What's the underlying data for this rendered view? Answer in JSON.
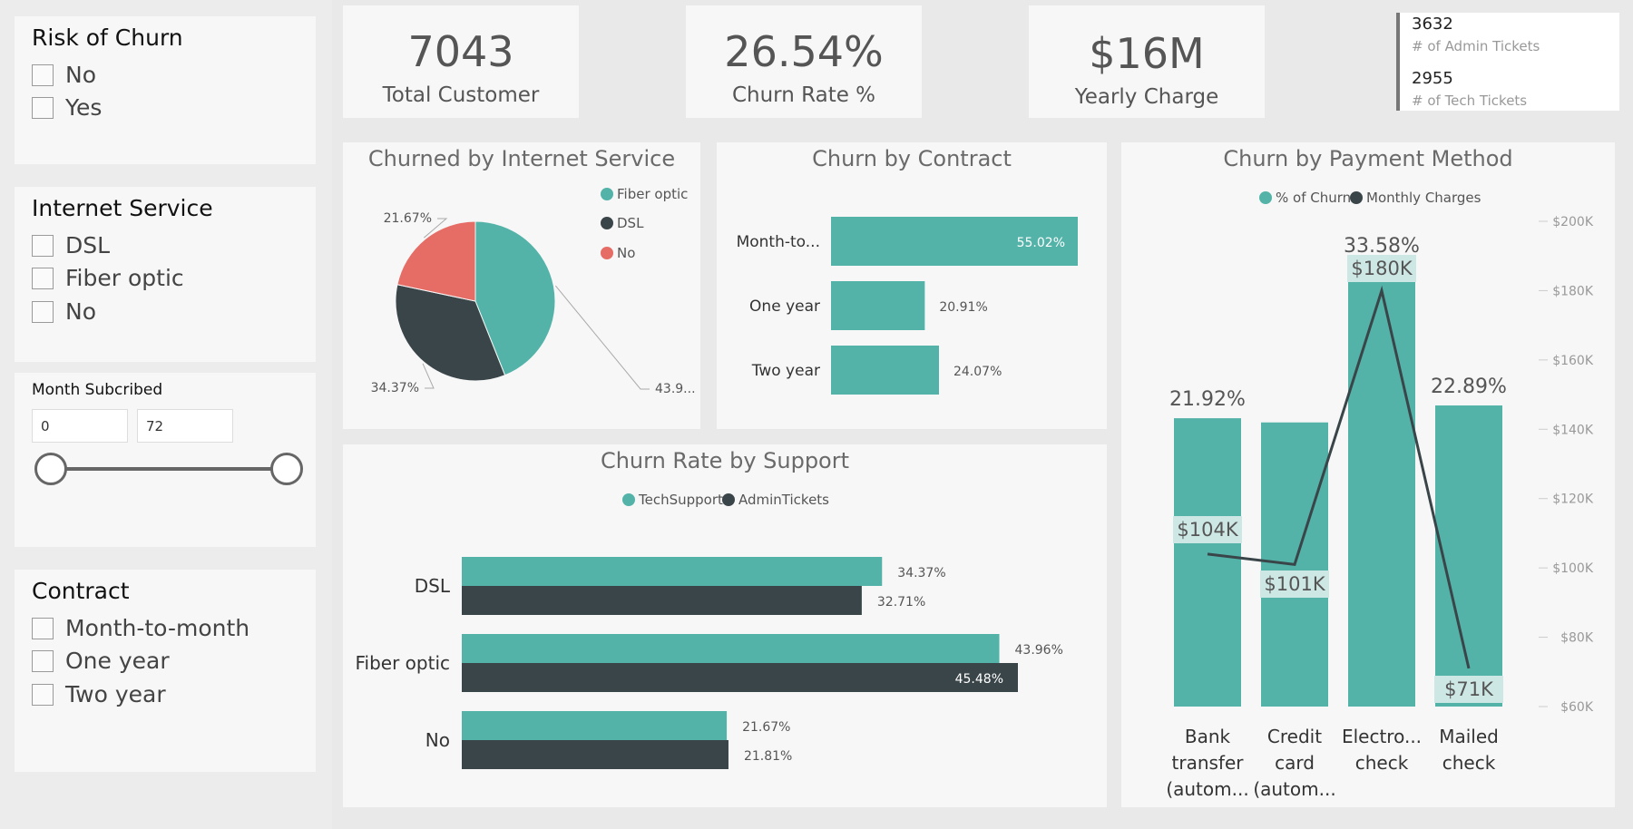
{
  "slicers": {
    "risk": {
      "title": "Risk of Churn",
      "options": [
        "No",
        "Yes"
      ]
    },
    "internet": {
      "title": "Internet Service",
      "options": [
        "DSL",
        "Fiber optic",
        "No"
      ]
    },
    "month": {
      "title": "Month Subcribed",
      "min": "0",
      "max": "72"
    },
    "contract": {
      "title": "Contract",
      "options": [
        "Month-to-month",
        "One year",
        "Two year"
      ]
    }
  },
  "kpis": [
    {
      "value": "7043",
      "label": "Total Customer"
    },
    {
      "value": "26.54%",
      "label": "Churn Rate %"
    },
    {
      "value": "$16M",
      "label": "Yearly Charge"
    }
  ],
  "tickets": {
    "admin_value": "3632",
    "admin_label": "# of Admin Tickets",
    "tech_value": "2955",
    "tech_label": "# of Tech Tickets"
  },
  "colors": {
    "teal": "#53b3a8",
    "dark": "#3a4549",
    "red": "#e66c66"
  },
  "chart_data": [
    {
      "type": "pie",
      "title": "Churned by Internet Service",
      "legend": [
        "Fiber optic",
        "DSL",
        "No"
      ],
      "categories": [
        "Fiber optic",
        "DSL",
        "No"
      ],
      "values": [
        43.96,
        34.37,
        21.67
      ],
      "labels": [
        "43.9...",
        "34.37%",
        "21.67%"
      ]
    },
    {
      "type": "bar",
      "orientation": "horizontal",
      "title": "Churn by Contract",
      "categories": [
        "Month-to...",
        "One year",
        "Two year"
      ],
      "values": [
        55.02,
        20.91,
        24.07
      ],
      "labels": [
        "55.02%",
        "20.91%",
        "24.07%"
      ]
    },
    {
      "type": "bar",
      "orientation": "horizontal",
      "title": "Churn Rate by Support",
      "categories": [
        "DSL",
        "Fiber optic",
        "No"
      ],
      "series": [
        {
          "name": "TechSupport",
          "values": [
            34.37,
            43.96,
            21.67
          ],
          "labels": [
            "34.37%",
            "43.96%",
            "21.67%"
          ]
        },
        {
          "name": "AdminTickets",
          "values": [
            32.71,
            45.48,
            21.81
          ],
          "labels": [
            "32.71%",
            "45.48%",
            "21.81%"
          ]
        }
      ]
    },
    {
      "type": "bar",
      "title": "Churn by Payment Method",
      "categories": [
        "Bank transfer (autom...",
        "Credit card (autom...",
        "Electro... check",
        "Mailed check"
      ],
      "category_lines": [
        [
          "Bank",
          "transfer",
          "(autom..."
        ],
        [
          "Credit",
          "card",
          "(autom..."
        ],
        [
          "Electro...",
          "check"
        ],
        [
          "Mailed",
          "check"
        ]
      ],
      "series": [
        {
          "name": "% of Churn",
          "type": "bar",
          "values": [
            21.92,
            21.6,
            33.58,
            22.89
          ],
          "labels": [
            "21.92%",
            "",
            "33.58%",
            "22.89%"
          ]
        },
        {
          "name": "Monthly Charges",
          "type": "line",
          "values": [
            104,
            101,
            180,
            71
          ],
          "labels": [
            "$104K",
            "$101K",
            "$180K",
            "$71K"
          ]
        }
      ],
      "y2_ticks": [
        "$200K",
        "$180K",
        "$160K",
        "$140K",
        "$120K",
        "$100K",
        "$80K",
        "$60K"
      ],
      "y2lim": [
        60,
        200
      ],
      "ylim": [
        0,
        40
      ]
    }
  ]
}
